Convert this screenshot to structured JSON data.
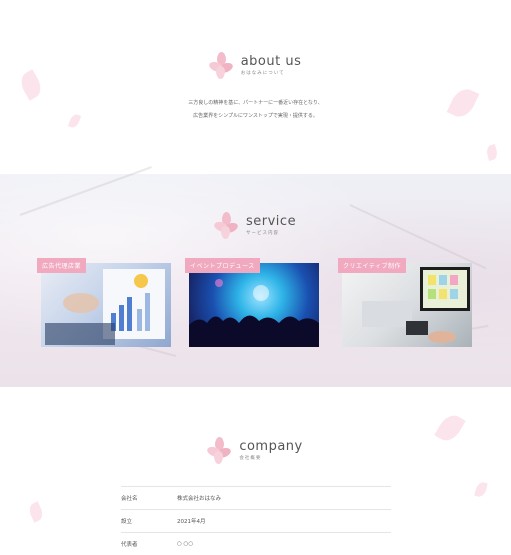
{
  "about": {
    "title": "about us",
    "subtitle": "おはなみについて",
    "lines": [
      "三方良しの精神を基に、パートナーに一番近い存在となり、",
      "広告業界をシンプルにワンストップで実現・提供する。"
    ]
  },
  "service": {
    "title": "service",
    "subtitle": "サービス内容",
    "cards": [
      {
        "label": "広告代理店業"
      },
      {
        "label": "イベントプロデュース"
      },
      {
        "label": "クリエイティブ制作"
      }
    ]
  },
  "company": {
    "title": "company",
    "subtitle": "会社概要",
    "rows": [
      {
        "key": "会社名",
        "value": "株式会社おはなみ"
      },
      {
        "key": "設立",
        "value": "2021年4月"
      },
      {
        "key": "代表者",
        "value": "○ ○○"
      }
    ]
  },
  "colors": {
    "accent": "#f1a9c0",
    "petal": "#f9dbe4"
  }
}
